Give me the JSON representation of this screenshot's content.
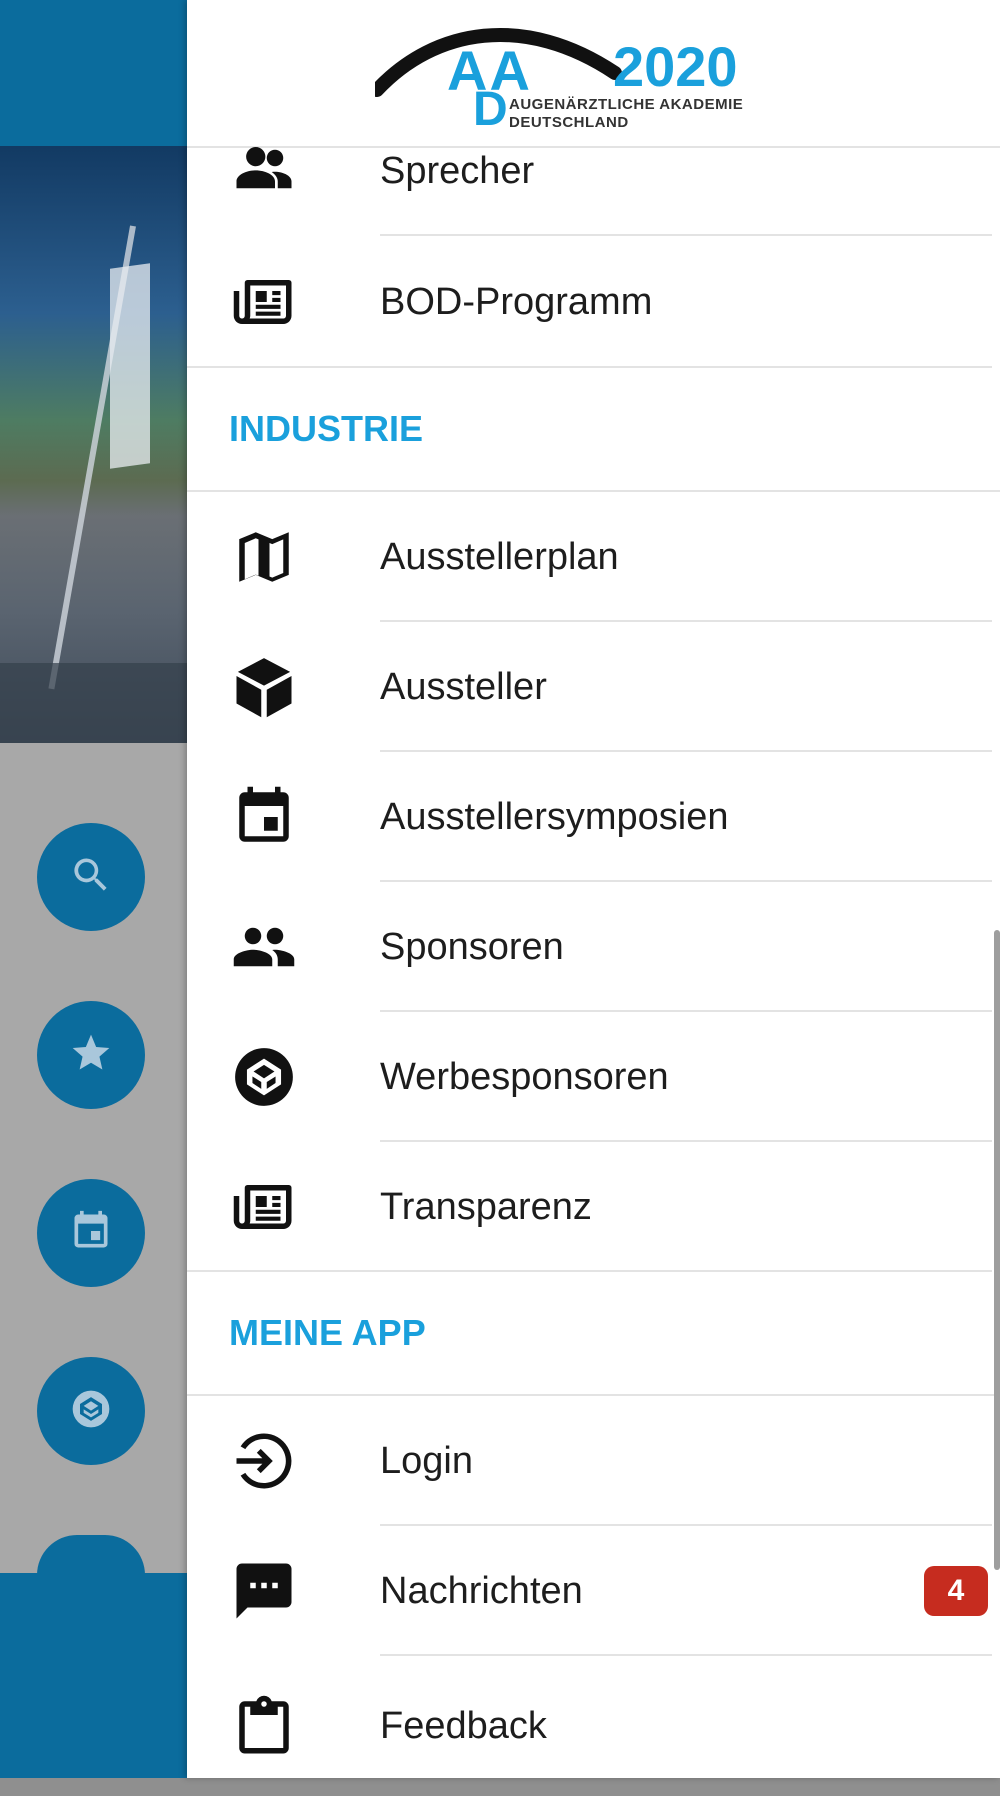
{
  "app": {
    "logo": {
      "aa": "AA",
      "d": "D",
      "year": "2020",
      "line1": "AUGENÄRZTLICHE AKADEMIE",
      "line2": "DEUTSCHLAND"
    }
  },
  "background": {
    "fabs": [
      {
        "icon": "search-icon"
      },
      {
        "icon": "star-icon"
      },
      {
        "icon": "calendar-icon"
      },
      {
        "icon": "codepen-icon"
      },
      {
        "icon": "gear-icon"
      }
    ]
  },
  "drawer": {
    "items_top": [
      {
        "label": "Sprecher",
        "icon": "speakers-icon"
      },
      {
        "label": "BOD-Programm",
        "icon": "newspaper-icon"
      }
    ],
    "section_industrie": "INDUSTRIE",
    "items_industrie": [
      {
        "label": "Ausstellerplan",
        "icon": "map-icon"
      },
      {
        "label": "Aussteller",
        "icon": "cube-icon"
      },
      {
        "label": "Ausstellersymposien",
        "icon": "calendar-icon"
      },
      {
        "label": "Sponsoren",
        "icon": "people-icon"
      },
      {
        "label": "Werbesponsoren",
        "icon": "codepen-icon"
      },
      {
        "label": "Transparenz",
        "icon": "newspaper-icon"
      }
    ],
    "section_meine_app": "MEINE APP",
    "items_meine_app": [
      {
        "label": "Login",
        "icon": "login-icon"
      },
      {
        "label": "Nachrichten",
        "icon": "chat-icon",
        "badge": "4"
      },
      {
        "label": "Feedback",
        "icon": "clipboard-icon"
      }
    ]
  },
  "colors": {
    "accent": "#1aa0dc",
    "brand_bar": "#0b6c9d",
    "badge": "#c62c1f"
  }
}
